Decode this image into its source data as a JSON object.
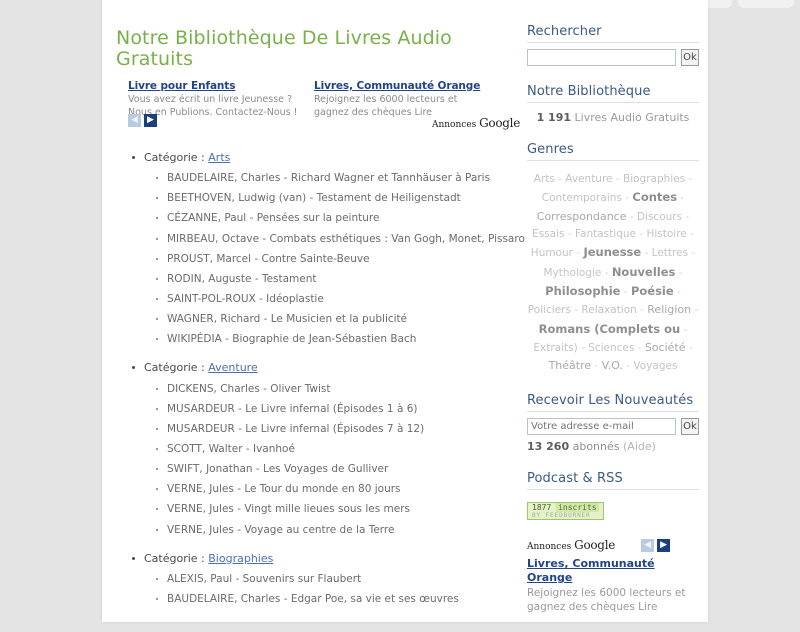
{
  "browser": {
    "tab_widths": [
      86,
      128,
      86,
      128,
      100,
      72,
      56
    ]
  },
  "main": {
    "title": "Notre Bibliothèque De Livres Audio Gratuits",
    "ads": {
      "annonces_label": "Annonces",
      "annonces_brand": "Google",
      "prev_icon": "chevron-left-icon",
      "next_icon": "chevron-right-icon",
      "items": [
        {
          "title": "Livre pour Enfants",
          "body": "Vous avez écrit un livre Jeunesse ? Nous en Publions. Contactez-Nous !"
        },
        {
          "title": "Livres, Communauté Orange",
          "body": "Rejoignez les 6000 lecteurs et gagnez des chèques Lire"
        }
      ]
    },
    "category_prefix": "Catégorie : ",
    "categories": [
      {
        "name": "Arts",
        "books": [
          "BAUDELAIRE, Charles - Richard Wagner et Tannhäuser à Paris",
          "BEETHOVEN, Ludwig (van) - Testament de Heiligenstadt",
          "CÉZANNE, Paul - Pensées sur la peinture",
          "MIRBEAU, Octave - Combats esthétiques : Van Gogh, Monet, Pissaro",
          "PROUST, Marcel - Contre Sainte-Beuve",
          "RODIN, Auguste - Testament",
          "SAINT-POL-ROUX - Idéoplastie",
          "WAGNER, Richard - Le Musicien et la publicité",
          "WIKIPÉDIA - Biographie de Jean-Sébastien Bach"
        ]
      },
      {
        "name": "Aventure",
        "books": [
          "DICKENS, Charles - Oliver Twist",
          "MUSARDEUR - Le Livre infernal (Épisodes 1 à 6)",
          "MUSARDEUR - Le Livre infernal (Épisodes 7 à 12)",
          "SCOTT, Walter - Ivanhoé",
          "SWIFT, Jonathan - Les Voyages de Gulliver",
          "VERNE, Jules - Le Tour du monde en 80 jours",
          "VERNE, Jules - Vingt mille lieues sous les mers",
          "VERNE, Jules - Voyage au centre de la Terre"
        ]
      },
      {
        "name": "Biographies",
        "books": [
          "ALEXIS, Paul - Souvenirs sur Flaubert",
          "BAUDELAIRE, Charles - Edgar Poe, sa vie et ses œuvres"
        ]
      }
    ]
  },
  "sidebar": {
    "search": {
      "heading": "Rechercher",
      "value": "",
      "placeholder": "",
      "ok_label": "Ok"
    },
    "library": {
      "heading": "Notre Bibliothèque",
      "count": "1 191",
      "count_suffix": " Livres Audio Gratuits"
    },
    "genres": {
      "heading": "Genres",
      "tags": [
        {
          "label": "Arts",
          "weight": 1
        },
        {
          "label": "Aventure",
          "weight": 1
        },
        {
          "label": "Biographies",
          "weight": 1
        },
        {
          "label": "Contemporains",
          "weight": 1
        },
        {
          "label": "Contes",
          "weight": 3
        },
        {
          "label": "Correspondance",
          "weight": 2
        },
        {
          "label": "Discours",
          "weight": 1
        },
        {
          "label": "Essais",
          "weight": 1
        },
        {
          "label": "Fantastique",
          "weight": 1
        },
        {
          "label": "Histoire",
          "weight": 1
        },
        {
          "label": "Humour",
          "weight": 1
        },
        {
          "label": "Jeunesse",
          "weight": 3
        },
        {
          "label": "Lettres",
          "weight": 1
        },
        {
          "label": "Mythologie",
          "weight": 1
        },
        {
          "label": "Nouvelles",
          "weight": 3
        },
        {
          "label": "Philosophie",
          "weight": 3
        },
        {
          "label": "Poésie",
          "weight": 3
        },
        {
          "label": "Policiers",
          "weight": 1
        },
        {
          "label": "Relaxation",
          "weight": 1
        },
        {
          "label": "Religion",
          "weight": 2
        },
        {
          "label": "Romans (Complets ou",
          "weight": 3
        },
        {
          "label": "Extraits)",
          "weight": 1
        },
        {
          "label": "Sciences",
          "weight": 1
        },
        {
          "label": "Société",
          "weight": 2
        },
        {
          "label": "Théâtre",
          "weight": 2
        },
        {
          "label": "V.O.",
          "weight": 2
        },
        {
          "label": "Voyages",
          "weight": 1
        }
      ],
      "separator": " - "
    },
    "newsletter": {
      "heading": "Recevoir Les Nouveautés",
      "value": "",
      "placeholder": "Votre adresse e-mail",
      "ok_label": "Ok",
      "subscribers_count": "13 260",
      "subscribers_label": " abonnés ",
      "help_label": "(Aide)"
    },
    "podcast": {
      "heading": "Podcast & RSS",
      "badge_count": "1877",
      "badge_word": "inscrits",
      "badge_footer": "BY FEEDBURNER"
    },
    "ad": {
      "annonces_label": "Annonces",
      "annonces_brand": "Google",
      "prev_icon": "chevron-left-icon",
      "next_icon": "chevron-right-icon",
      "title": "Livres, Communauté Orange",
      "body": "Rejoignez les 6000 lecteurs et gagnez des chèques Lire"
    }
  }
}
